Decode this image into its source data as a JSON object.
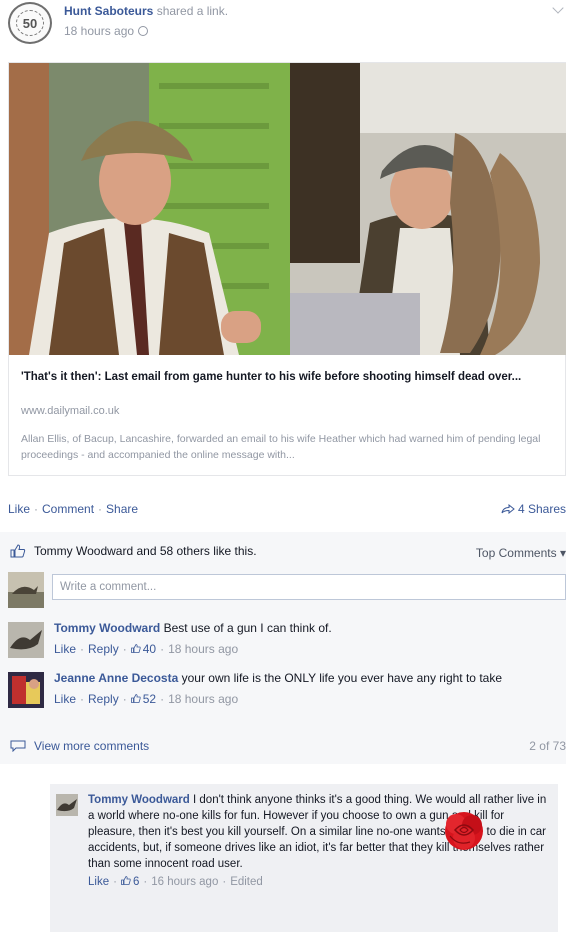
{
  "post": {
    "page_name": "Hunt Saboteurs",
    "action": "shared a link.",
    "time": "18 hours ago",
    "avatar_text": "50"
  },
  "preview": {
    "title": "'That's it then': Last email from game hunter to his wife before shooting himself dead over...",
    "domain": "www.dailymail.co.uk",
    "description": "Allan Ellis, of Bacup, Lancashire, forwarded an email to his wife Heather which had warned him of pending legal proceedings - and accompanied the online message with..."
  },
  "actions": {
    "like": "Like",
    "comment": "Comment",
    "share": "Share",
    "shares_count": "4 Shares"
  },
  "likes": {
    "text": "Tommy Woodward and 58 others like this.",
    "sort_label": "Top Comments"
  },
  "comment_box": {
    "placeholder": "Write a comment..."
  },
  "comments": [
    {
      "author": "Tommy Woodward",
      "text": "Best use of a gun I can think of.",
      "like": "Like",
      "reply": "Reply",
      "likes": "40",
      "time": "18 hours ago"
    },
    {
      "author": "Jeanne Anne Decosta",
      "text": "your own life is the ONLY life you ever have any right to take",
      "like": "Like",
      "reply": "Reply",
      "likes": "52",
      "time": "18 hours ago"
    }
  ],
  "view_more": {
    "label": "View more comments",
    "count": "2 of 73"
  },
  "reply": {
    "author": "Tommy Woodward",
    "text": "I don't think anyone thinks it's a good thing. We would all rather live in a world where no-one kills for fun. However if you choose to own a gun and kill for pleasure, then it's best you kill yourself. On a similar line no-one wants people to die in car accidents, but, if someone drives like an idiot, it's far better that they kill themselves rather than some innocent road user.",
    "like": "Like",
    "likes": "6",
    "time": "16 hours ago",
    "edited": "Edited"
  },
  "colors": {
    "link": "#3b5998",
    "muted": "#9197a3",
    "panel": "#f6f7f9",
    "reply_panel": "#eff0f3",
    "rose": "#d7141d"
  }
}
